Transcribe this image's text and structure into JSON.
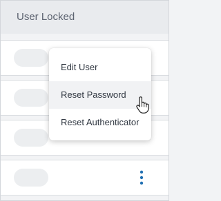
{
  "header": {
    "title": "User Locked"
  },
  "rows": [
    {
      "locked": false,
      "menu_icon": "kebab-icon"
    },
    {
      "locked": false,
      "menu_icon": "kebab-icon"
    },
    {
      "locked": false,
      "menu_icon": "kebab-icon"
    },
    {
      "locked": false,
      "menu_icon": "kebab-icon"
    }
  ],
  "menu": {
    "items": [
      {
        "label": "Edit User"
      },
      {
        "label": "Reset Password",
        "hovered": true
      },
      {
        "label": "Reset Authenticator"
      }
    ]
  },
  "colors": {
    "accent": "#1f6fb2",
    "menu_hover": "#f1f2f4",
    "toggle_off": "#eceef0"
  },
  "cursor": {
    "icon": "hand-pointer-icon"
  }
}
